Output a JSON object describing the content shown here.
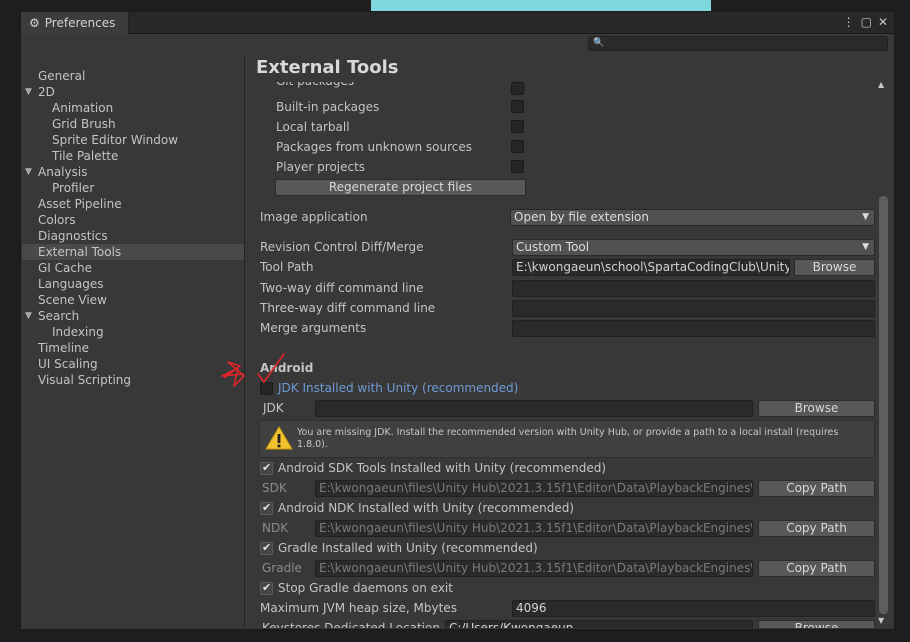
{
  "window": {
    "title": "Preferences",
    "controls": [
      "more-icon",
      "maximize-icon",
      "close-icon"
    ],
    "search_placeholder": ""
  },
  "sidebar": {
    "items": [
      {
        "label": "General",
        "level": 0
      },
      {
        "label": "2D",
        "level": 0,
        "expanded": true
      },
      {
        "label": "Animation",
        "level": 1
      },
      {
        "label": "Grid Brush",
        "level": 1
      },
      {
        "label": "Sprite Editor Window",
        "level": 1
      },
      {
        "label": "Tile Palette",
        "level": 1
      },
      {
        "label": "Analysis",
        "level": 0,
        "expanded": true
      },
      {
        "label": "Profiler",
        "level": 1
      },
      {
        "label": "Asset Pipeline",
        "level": 0
      },
      {
        "label": "Colors",
        "level": 0
      },
      {
        "label": "Diagnostics",
        "level": 0
      },
      {
        "label": "External Tools",
        "level": 0,
        "selected": true
      },
      {
        "label": "GI Cache",
        "level": 0
      },
      {
        "label": "Languages",
        "level": 0
      },
      {
        "label": "Scene View",
        "level": 0
      },
      {
        "label": "Search",
        "level": 0,
        "expanded": true
      },
      {
        "label": "Indexing",
        "level": 1
      },
      {
        "label": "Timeline",
        "level": 0
      },
      {
        "label": "UI Scaling",
        "level": 0
      },
      {
        "label": "Visual Scripting",
        "level": 0
      }
    ]
  },
  "main": {
    "title": "External Tools",
    "partial_top_label": "Git packages",
    "package_options": [
      {
        "label": "Built-in packages",
        "checked": false
      },
      {
        "label": "Local tarball",
        "checked": false
      },
      {
        "label": "Packages from unknown sources",
        "checked": false
      },
      {
        "label": "Player projects",
        "checked": false
      }
    ],
    "regenerate_button": "Regenerate project files",
    "image_application": {
      "label": "Image application",
      "value": "Open by file extension"
    },
    "revision_control": {
      "label": "Revision Control Diff/Merge",
      "value": "Custom Tool"
    },
    "tool_path": {
      "label": "Tool Path",
      "value": "E:\\kwongaeun\\school\\SpartaCodingClub\\Unity\\de",
      "browse": "Browse"
    },
    "two_way": {
      "label": "Two-way diff command line",
      "value": ""
    },
    "three_way": {
      "label": "Three-way diff command line",
      "value": ""
    },
    "merge_args": {
      "label": "Merge arguments",
      "value": ""
    },
    "android": {
      "section": "Android",
      "jdk_checkbox": {
        "label": "JDK Installed with Unity (recommended)",
        "checked": false
      },
      "jdk": {
        "label": "JDK",
        "value": "",
        "browse": "Browse"
      },
      "jdk_warning": "You are missing JDK. Install the recommended version with Unity Hub, or provide a path to a local install (requires 1.8.0).",
      "sdk_checkbox": {
        "label": "Android SDK Tools Installed with Unity (recommended)",
        "checked": true
      },
      "sdk": {
        "label": "SDK",
        "value": "E:\\kwongaeun\\files\\Unity Hub\\2021.3.15f1\\Editor\\Data\\PlaybackEngines\\Andr",
        "button": "Copy Path"
      },
      "ndk_checkbox": {
        "label": "Android NDK Installed with Unity (recommended)",
        "checked": true
      },
      "ndk": {
        "label": "NDK",
        "value": "E:\\kwongaeun\\files\\Unity Hub\\2021.3.15f1\\Editor\\Data\\PlaybackEngines\\Andr",
        "button": "Copy Path"
      },
      "gradle_checkbox": {
        "label": "Gradle Installed with Unity (recommended)",
        "checked": true
      },
      "gradle": {
        "label": "Gradle",
        "value": "E:\\kwongaeun\\files\\Unity Hub\\2021.3.15f1\\Editor\\Data\\PlaybackEngines\\Andr",
        "button": "Copy Path"
      },
      "stop_gradle": {
        "label": "Stop Gradle daemons on exit",
        "checked": true
      },
      "jvm_heap": {
        "label": "Maximum JVM heap size, Mbytes",
        "value": "4096"
      },
      "keystores": {
        "label": "Keystores Dedicated Location",
        "value": "C:/Users/Kwongaeun",
        "browse": "Browse"
      }
    }
  },
  "colors": {
    "annotation": "#e0262a",
    "link": "#6e9bd6",
    "warning": "#f2c12e"
  }
}
